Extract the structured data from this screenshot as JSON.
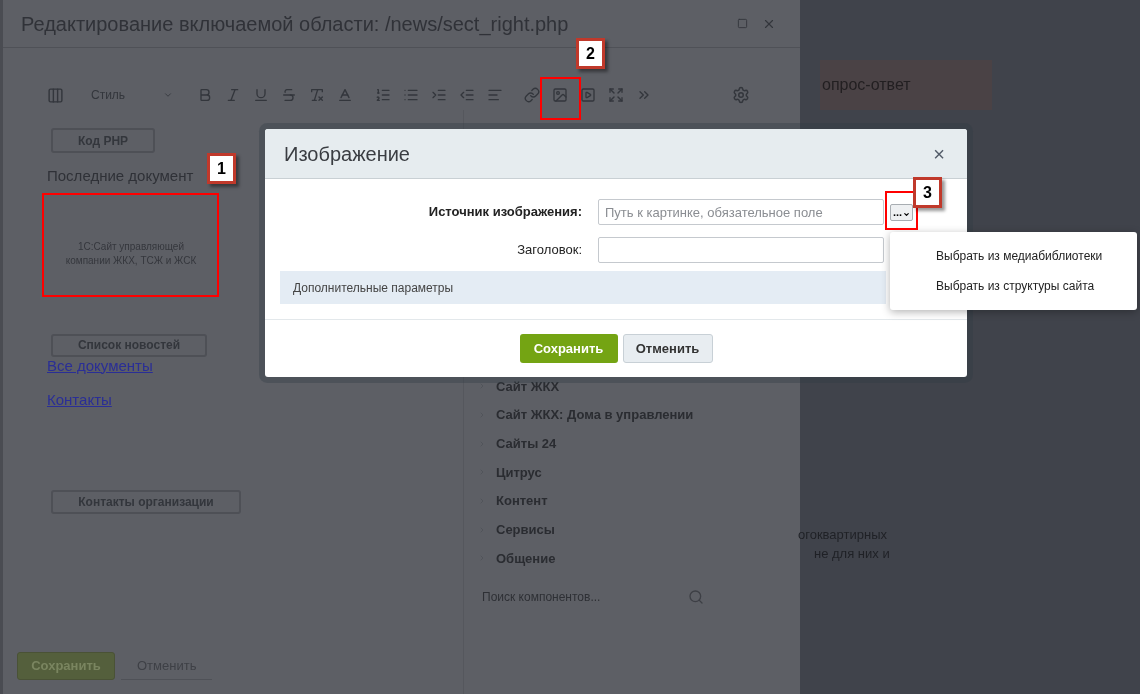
{
  "editor": {
    "title": "Редактирование включаемой области: /news/sect_right.php",
    "toolbar": {
      "style_label": "Стиль"
    },
    "content": {
      "php_button": "Код PHP",
      "heading": "Последние документ",
      "block_text": "1С:Сайт управляющей компании ЖКХ, ТСЖ и ЖСК",
      "news_button": "Список новостей",
      "links": [
        "Все документы",
        "Контакты"
      ],
      "contacts_button": "Контакты организации"
    },
    "components": {
      "items": [
        {
          "label": "Сайт ЖКХ"
        },
        {
          "label": "Сайт ЖКХ: Дома в управлении"
        },
        {
          "label": "Сайты 24"
        },
        {
          "label": "Цитрус"
        },
        {
          "label": "Контент"
        },
        {
          "label": "Сервисы"
        },
        {
          "label": "Общение"
        }
      ],
      "search_placeholder": "Поиск компонентов..."
    },
    "footer": {
      "save": "Сохранить",
      "cancel": "Отменить"
    }
  },
  "page_behind": {
    "button": "опрос-ответ",
    "text_lines": [
      "огоквартирных",
      "не для них и"
    ]
  },
  "dialog": {
    "title": "Изображение",
    "close": "×",
    "fields": [
      {
        "label": "Источник изображения:",
        "placeholder": "Путь к картинке, обязательное поле",
        "browse": "...",
        "bold": true
      },
      {
        "label": "Заголовок:",
        "bold": false
      }
    ],
    "section": "Дополнительные параметры",
    "save": "Сохранить",
    "cancel": "Отменить"
  },
  "menu": {
    "items": [
      "Выбрать из медиабиблиотеки",
      "Выбрать из структуры сайта"
    ]
  },
  "callouts": [
    "1",
    "2",
    "3"
  ]
}
